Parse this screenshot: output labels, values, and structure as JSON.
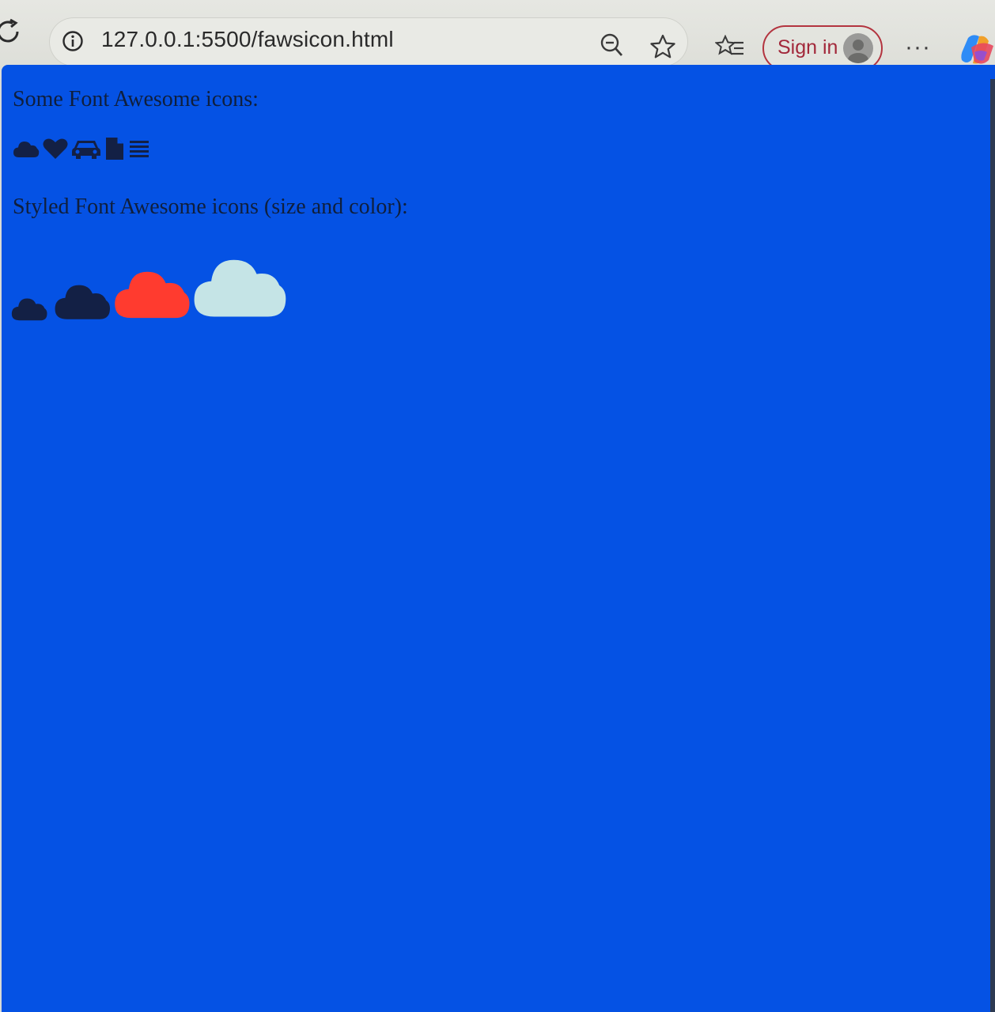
{
  "browser": {
    "url": "127.0.0.1:5500/fawsicon.html",
    "sign_in_label": "Sign in",
    "more_label": "···",
    "icons": [
      "reload-icon",
      "info-icon",
      "zoom-out-icon",
      "favorite-star-icon",
      "favorites-list-icon",
      "avatar",
      "more-icon",
      "copilot-icon"
    ]
  },
  "page": {
    "background_color": "#0552e4",
    "heading_1": "Some Font Awesome icons:",
    "icons_row_1": [
      "cloud-icon",
      "heart-icon",
      "car-icon",
      "file-icon",
      "bars-icon"
    ],
    "heading_2": "Styled Font Awesome icons (size and color):",
    "styled_clouds": [
      {
        "icon": "cloud-icon",
        "color": "#132045"
      },
      {
        "icon": "cloud-icon",
        "color": "#132045"
      },
      {
        "icon": "cloud-icon",
        "color": "#ff3b2f"
      },
      {
        "icon": "cloud-icon",
        "color": "#c5e4e6"
      }
    ]
  }
}
